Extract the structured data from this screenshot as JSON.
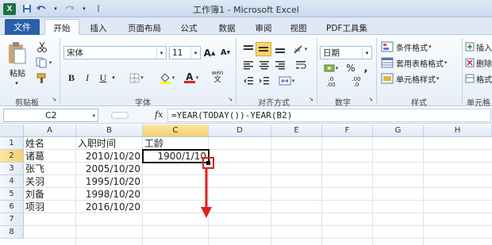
{
  "window": {
    "title": "工作簿1 - Microsoft Excel",
    "app_icon": "X"
  },
  "tabs": [
    {
      "label": "文件"
    },
    {
      "label": "开始"
    },
    {
      "label": "插入"
    },
    {
      "label": "页面布局"
    },
    {
      "label": "公式"
    },
    {
      "label": "数据"
    },
    {
      "label": "审阅"
    },
    {
      "label": "视图"
    },
    {
      "label": "PDF工具集"
    }
  ],
  "ribbon": {
    "clipboard": {
      "paste_label": "粘贴",
      "group_label": "剪贴板"
    },
    "font": {
      "name": "宋体",
      "size": "11",
      "group_label": "字体",
      "grow": "A",
      "shrink": "A",
      "bold": "B",
      "italic": "I",
      "underline": "U",
      "font_color_letter": "A",
      "highlight": "ab",
      "wen": "wén"
    },
    "alignment": {
      "group_label": "对齐方式"
    },
    "number": {
      "format": "日期",
      "group_label": "数字",
      "percent": "%",
      "comma": ",",
      "dec_inc": ".0",
      "dec_dec": ".00"
    },
    "styles": {
      "conditional": "条件格式",
      "table": "套用表格格式",
      "cell": "单元格样式",
      "group_label": "样式"
    },
    "cells": {
      "insert": "插入",
      "delete": "删除",
      "format": "格式",
      "group_label": "单元格"
    }
  },
  "formula_bar": {
    "name_box": "C2",
    "fx": "fx",
    "formula": "=YEAR(TODAY())-YEAR(B2)"
  },
  "columns": [
    "A",
    "B",
    "C",
    "D",
    "E",
    "F",
    "G",
    "H"
  ],
  "rows": [
    "1",
    "2",
    "3",
    "4",
    "5",
    "6",
    "7",
    "8"
  ],
  "cells": {
    "A1": "姓名",
    "B1": "入职时间",
    "C1": "工龄",
    "A2": "诸葛",
    "B2": "2010/10/20",
    "C2": "1900/1/10",
    "A3": "张飞",
    "B3": "2005/10/20",
    "A4": "关羽",
    "B4": "1995/10/20",
    "A5": "刘备",
    "B5": "1998/10/20",
    "A6": "项羽",
    "B6": "2016/10/20"
  },
  "colors": {
    "annotation": "#e02020",
    "selection": "#111111",
    "file_tab": "#2a5fa8"
  }
}
